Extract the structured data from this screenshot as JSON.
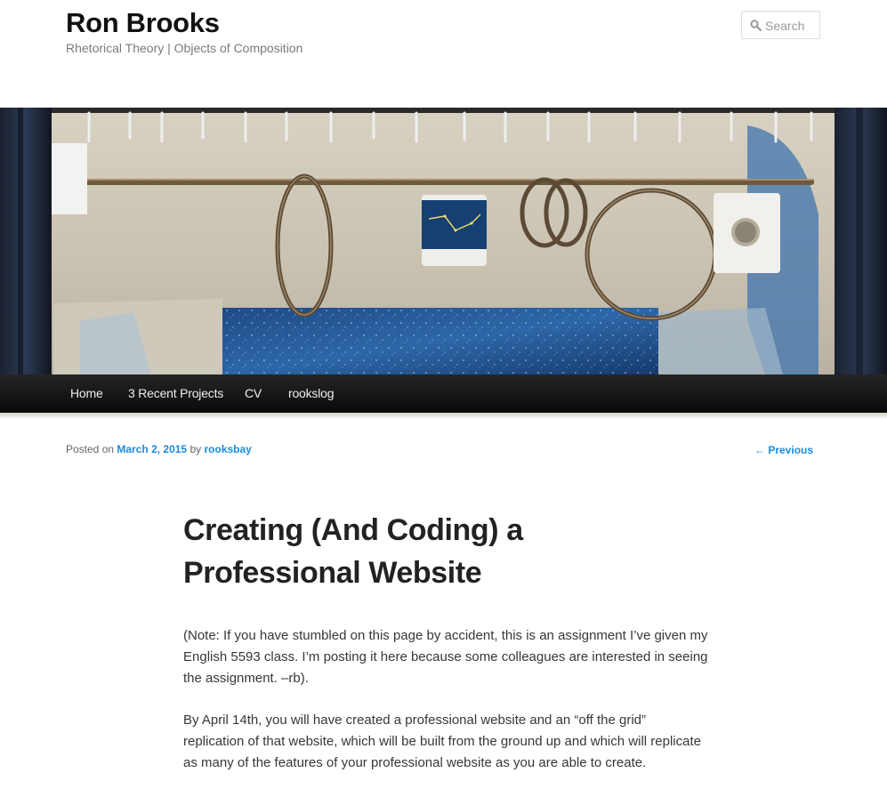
{
  "site": {
    "title": "Ron Brooks",
    "description": "Rhetorical Theory | Objects of Composition"
  },
  "search": {
    "placeholder": "Search",
    "icon": "search-icon"
  },
  "nav": {
    "items": [
      {
        "label": "Home"
      },
      {
        "label": "3 Recent Projects"
      },
      {
        "label": "CV"
      },
      {
        "label": "rookslog"
      }
    ]
  },
  "post": {
    "posted_on_label": "Posted on",
    "date": "March 2, 2015",
    "by_label": "by",
    "author": "rooksbay",
    "previous_link": "← Previous",
    "title": "Creating (And Coding) a Professional Website",
    "paragraphs": [
      "(Note: If you have stumbled on this page by accident, this is an assignment I’ve given my English 5593 class. I’m posting it here because some colleagues are interested in seeing the assignment. –rb).",
      "By April 14th, you will have created a professional website and an “off the grid” replication of that website, which will be built from the ground up and which will replicate as many of the features of your professional website as you are able to create."
    ]
  },
  "colors": {
    "link": "#1b8be0",
    "nav_bg": "#111111",
    "title": "#111111"
  }
}
